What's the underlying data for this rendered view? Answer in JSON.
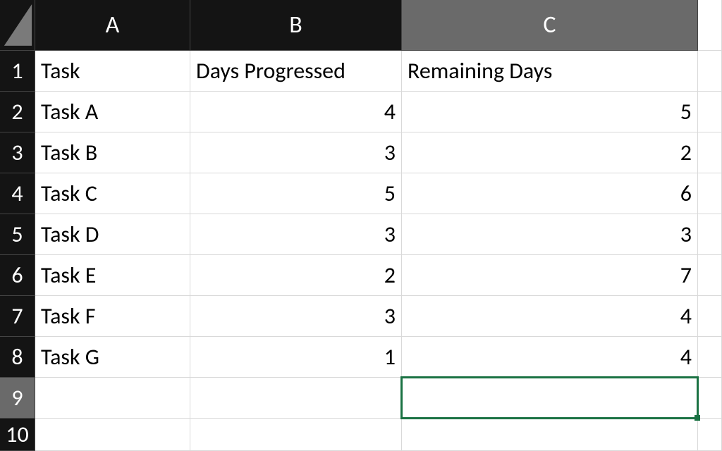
{
  "columns": {
    "A": "A",
    "B": "B",
    "C": "C"
  },
  "rowNumbers": {
    "r1": "1",
    "r2": "2",
    "r3": "3",
    "r4": "4",
    "r5": "5",
    "r6": "6",
    "r7": "7",
    "r8": "8",
    "r9": "9",
    "r10": "10"
  },
  "header": {
    "task": "Task",
    "progressed": "Days Progressed",
    "remaining": "Remaining Days"
  },
  "rows": [
    {
      "task": "Task A",
      "progressed": "4",
      "remaining": "5"
    },
    {
      "task": "Task B",
      "progressed": "3",
      "remaining": "2"
    },
    {
      "task": "Task C",
      "progressed": "5",
      "remaining": "6"
    },
    {
      "task": "Task D",
      "progressed": "3",
      "remaining": "3"
    },
    {
      "task": "Task E",
      "progressed": "2",
      "remaining": "7"
    },
    {
      "task": "Task F",
      "progressed": "3",
      "remaining": "4"
    },
    {
      "task": "Task G",
      "progressed": "1",
      "remaining": "4"
    }
  ],
  "selection": {
    "activeCell": "C9",
    "selectedColumn": "C",
    "selectedRow": "9"
  },
  "colors": {
    "headerBg": "#141414",
    "selectedHeaderBg": "#6a6a6a",
    "selectionBorder": "#1a7243",
    "gridLine": "#d9d9d9"
  },
  "chart_data": {
    "type": "table",
    "title": "",
    "columns": [
      "Task",
      "Days Progressed",
      "Remaining Days"
    ],
    "rows": [
      [
        "Task A",
        4,
        5
      ],
      [
        "Task B",
        3,
        2
      ],
      [
        "Task C",
        5,
        6
      ],
      [
        "Task D",
        3,
        3
      ],
      [
        "Task E",
        2,
        7
      ],
      [
        "Task F",
        3,
        4
      ],
      [
        "Task G",
        1,
        4
      ]
    ]
  }
}
